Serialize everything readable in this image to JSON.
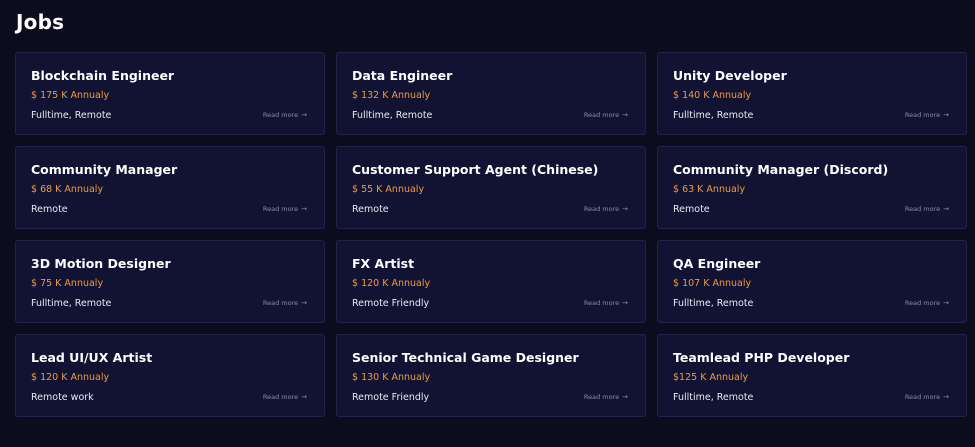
{
  "page": {
    "title": "Jobs"
  },
  "colors": {
    "background": "#0d0c1f",
    "card": "#121233",
    "salary": "#f29a38"
  },
  "jobs": [
    {
      "title": "Blockchain Engineer",
      "salary": "$ 175 K Annualy",
      "type": "Fulltime, Remote",
      "read_more": "Read more"
    },
    {
      "title": "Data Engineer",
      "salary": "$ 132 K Annualy",
      "type": "Fulltime, Remote",
      "read_more": "Read more"
    },
    {
      "title": "Unity Developer",
      "salary": "$ 140 K Annualy",
      "type": "Fulltime, Remote",
      "read_more": "Read more"
    },
    {
      "title": "Community Manager",
      "salary": "$ 68 K Annualy",
      "type": "Remote",
      "read_more": "Read more"
    },
    {
      "title": "Customer Support Agent (Chinese)",
      "salary": "$ 55 K Annualy",
      "type": "Remote",
      "read_more": "Read more"
    },
    {
      "title": "Community Manager (Discord)",
      "salary": "$ 63 K Annualy",
      "type": "Remote",
      "read_more": "Read more"
    },
    {
      "title": "3D Motion Designer",
      "salary": "$ 75 K Annualy",
      "type": "Fulltime, Remote",
      "read_more": "Read more"
    },
    {
      "title": "FX Artist",
      "salary": "$ 120 K Annualy",
      "type": "Remote Friendly",
      "read_more": "Read more"
    },
    {
      "title": "QA Engineer",
      "salary": "$ 107 K Annualy",
      "type": "Fulltime, Remote",
      "read_more": "Read more"
    },
    {
      "title": "Lead UI/UX Artist",
      "salary": "$ 120 K Annualy",
      "type": "Remote work",
      "read_more": "Read more"
    },
    {
      "title": "Senior Technical Game Designer",
      "salary": "$ 130 K Annualy",
      "type": "Remote Friendly",
      "read_more": "Read more"
    },
    {
      "title": "Teamlead PHP Developer",
      "salary": "$125 K Annualy",
      "type": "Fulltime, Remote",
      "read_more": "Read more"
    }
  ]
}
